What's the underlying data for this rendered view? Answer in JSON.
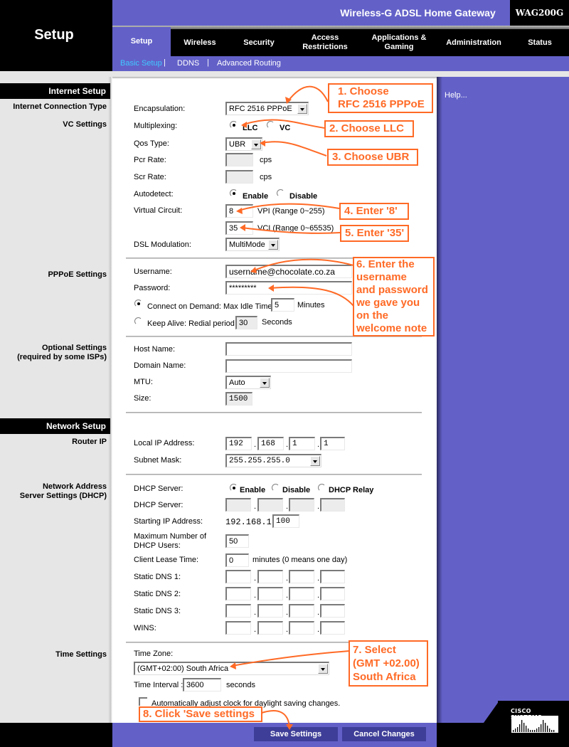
{
  "header": {
    "section_title": "Setup",
    "product_name": "Wireless-G ADSL Home Gateway",
    "model": "WAG200G"
  },
  "nav": {
    "tabs": [
      {
        "label": "Setup",
        "active": true
      },
      {
        "label": "Wireless"
      },
      {
        "label": "Security"
      },
      {
        "label": "Access Restrictions"
      },
      {
        "label": "Applications & Gaming"
      },
      {
        "label": "Administration"
      },
      {
        "label": "Status"
      }
    ],
    "subtabs": [
      {
        "label": "Basic Setup",
        "active": true
      },
      {
        "label": "DDNS"
      },
      {
        "label": "Advanced Routing"
      }
    ],
    "sep": "|"
  },
  "help_link": "Help...",
  "sections": {
    "internet_setup": "Internet Setup",
    "connection_type": "Internet Connection Type",
    "vc_settings": "VC Settings",
    "pppoe_settings": "PPPoE Settings",
    "optional_settings": "Optional Settings",
    "optional_note": "(required by some ISPs)",
    "network_setup": "Network Setup",
    "router_ip": "Router IP",
    "dhcp_title": "Network Address",
    "dhcp_sub": "Server Settings (DHCP)",
    "time_settings": "Time Settings"
  },
  "vc": {
    "encapsulation_label": "Encapsulation:",
    "encapsulation_value": "RFC 2516 PPPoE",
    "multiplexing_label": "Multiplexing:",
    "multiplexing_options": [
      "LLC",
      "VC"
    ],
    "multiplexing_selected": "LLC",
    "qos_label": "Qos Type:",
    "qos_value": "UBR",
    "pcr_label": "Pcr Rate:",
    "pcr_value": "",
    "scr_label": "Scr Rate:",
    "scr_value": "",
    "rate_unit": "cps",
    "autodetect_label": "Autodetect:",
    "autodetect_options": [
      "Enable",
      "Disable"
    ],
    "autodetect_selected": "Enable",
    "vc_label": "Virtual Circuit:",
    "vpi_value": "8",
    "vpi_hint": "VPI (Range 0~255)",
    "vci_value": "35",
    "vci_hint": "VCI (Range 0~65535)",
    "dsl_label": "DSL Modulation:",
    "dsl_value": "MultiMode"
  },
  "pppoe": {
    "username_label": "Username:",
    "username_value": "username@chocolate.co.za",
    "password_label": "Password:",
    "password_value": "*********",
    "connect_demand_label": "Connect on Demand: Max Idle Time",
    "idle_value": "5",
    "idle_unit": "Minutes",
    "keep_alive_label": "Keep Alive: Redial period",
    "redial_value": "30",
    "redial_unit": "Seconds",
    "mode_selected": "Connect on Demand"
  },
  "optional": {
    "host_label": "Host Name:",
    "host_value": "",
    "domain_label": "Domain Name:",
    "domain_value": "",
    "mtu_label": "MTU:",
    "mtu_value": "Auto",
    "size_label": "Size:",
    "size_value": "1500"
  },
  "router": {
    "local_ip_label": "Local IP Address:",
    "local_ip": [
      "192",
      "168",
      "1",
      "1"
    ],
    "subnet_label": "Subnet Mask:",
    "subnet_value": "255.255.255.0"
  },
  "dhcp": {
    "server_label": "DHCP Server:",
    "server_options": [
      "Enable",
      "Disable",
      "DHCP Relay"
    ],
    "server_selected": "Enable",
    "relay_label": "DHCP Server:",
    "relay_ip": [
      "",
      "",
      "",
      ""
    ],
    "start_label": "Starting IP Address:",
    "start_prefix": "192.168.1.",
    "start_value": "100",
    "max_label_1": "Maximum Number of",
    "max_label_2": "DHCP Users:",
    "max_value": "50",
    "lease_label": "Client Lease Time:",
    "lease_value": "0",
    "lease_unit": "minutes (0 means one day)",
    "dns1_label": "Static DNS 1:",
    "dns2_label": "Static DNS 2:",
    "dns3_label": "Static DNS 3:",
    "wins_label": "WINS:"
  },
  "time": {
    "zone_label": "Time Zone:",
    "zone_value": "(GMT+02:00) South Africa",
    "interval_label": "Time Interval :",
    "interval_value": "3600",
    "interval_unit": "seconds",
    "dst_label": "Automatically adjust clock for daylight saving changes.",
    "dst_checked": false
  },
  "footer": {
    "save_label": "Save Settings",
    "cancel_label": "Cancel Changes",
    "brand": "CISCO SYSTEMS"
  },
  "annotations": {
    "a1_line1": "1. Choose",
    "a1_line2": "RFC 2516 PPPoE",
    "a2": "2. Choose LLC",
    "a3": "3. Choose UBR",
    "a4": "4. Enter '8'",
    "a5": "5. Enter '35'",
    "a6_lines": [
      "6. Enter the",
      "username",
      "and password",
      "we gave you",
      "on the",
      "welcome note"
    ],
    "a7_lines": [
      "7. Select",
      "(GMT +02.00)",
      "South Africa"
    ],
    "a8": "8. Click 'Save settings",
    "color": "#ff6a26"
  },
  "colors": {
    "brand_purple": "#6361c8",
    "sidebar_grey": "#e6e6e6",
    "active_subtab": "#40c8ff"
  }
}
